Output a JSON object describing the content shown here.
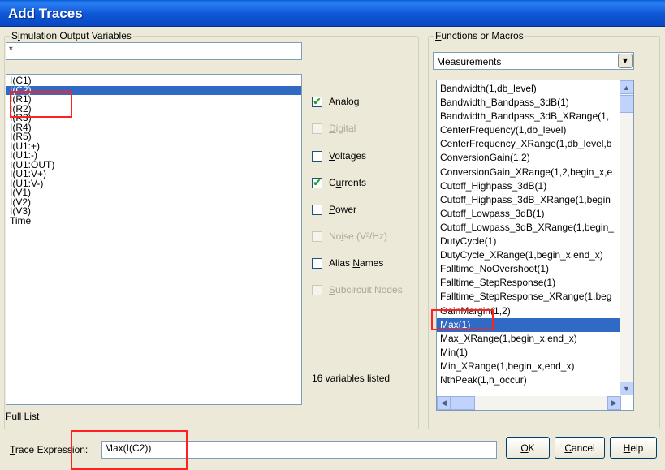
{
  "window": {
    "title": "Add Traces"
  },
  "sim_vars": {
    "legend_prefix": "S",
    "legend_accel": "i",
    "legend_rest": "mulation Output Variables",
    "filter_value": "*",
    "items": [
      "I(C1)",
      "I(C2)",
      "I(R1)",
      "I(R2)",
      "I(R3)",
      "I(R4)",
      "I(R5)",
      "I(U1:+)",
      "I(U1:-)",
      "I(U1:OUT)",
      "I(U1:V+)",
      "I(U1:V-)",
      "I(V1)",
      "I(V2)",
      "I(V3)",
      "Time"
    ],
    "selected_index": 1,
    "count_text": "16 variables listed",
    "full_list": "Full List"
  },
  "filters": [
    {
      "accel": "A",
      "rest": "nalog",
      "checked": true,
      "disabled": false
    },
    {
      "accel": "D",
      "rest": "igital",
      "checked": false,
      "disabled": true
    },
    {
      "accel": "V",
      "rest": "oltages",
      "checked": false,
      "disabled": false
    },
    {
      "pre": "C",
      "accel": "u",
      "rest": "rrents",
      "checked": true,
      "disabled": false
    },
    {
      "accel": "P",
      "rest": "ower",
      "checked": false,
      "disabled": false
    },
    {
      "pre": "No",
      "accel": "i",
      "rest": "se (V²/Hz)",
      "checked": false,
      "disabled": true
    },
    {
      "pre": "Alias ",
      "accel": "N",
      "rest": "ames",
      "checked": false,
      "disabled": false
    },
    {
      "accel": "S",
      "rest": "ubcircuit Nodes",
      "checked": false,
      "disabled": true
    }
  ],
  "functions": {
    "legend_accel": "F",
    "legend_rest": "unctions or Macros",
    "dropdown_value": "Measurements",
    "items": [
      "Bandwidth(1,db_level)",
      "Bandwidth_Bandpass_3dB(1)",
      "Bandwidth_Bandpass_3dB_XRange(1,",
      "CenterFrequency(1,db_level)",
      "CenterFrequency_XRange(1,db_level,b",
      "ConversionGain(1,2)",
      "ConversionGain_XRange(1,2,begin_x,e",
      "Cutoff_Highpass_3dB(1)",
      "Cutoff_Highpass_3dB_XRange(1,begin",
      "Cutoff_Lowpass_3dB(1)",
      "Cutoff_Lowpass_3dB_XRange(1,begin_",
      "DutyCycle(1)",
      "DutyCycle_XRange(1,begin_x,end_x)",
      "Falltime_NoOvershoot(1)",
      "Falltime_StepResponse(1)",
      "Falltime_StepResponse_XRange(1,beg",
      "GainMargin(1,2)",
      "Max(1)",
      "Max_XRange(1,begin_x,end_x)",
      "Min(1)",
      "Min_XRange(1,begin_x,end_x)",
      "NthPeak(1,n_occur)"
    ],
    "selected_index": 17
  },
  "trace": {
    "label_accel": "T",
    "label_rest": "race Expression:",
    "value": "Max(I(C2))"
  },
  "buttons": {
    "ok_accel": "O",
    "ok_rest": "K",
    "cancel_accel": "C",
    "cancel_rest": "ancel",
    "help_accel": "H",
    "help_rest": "elp"
  }
}
